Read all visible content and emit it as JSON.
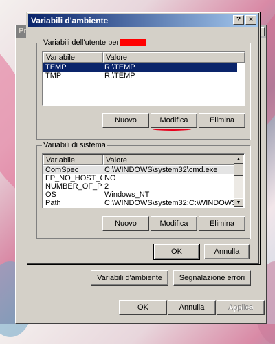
{
  "background_window": {
    "title": "Pro",
    "close_label": "×",
    "buttons": {
      "env_vars": "Variabili d'ambiente",
      "error_report": "Segnalazione errori",
      "ok": "OK",
      "cancel": "Annulla",
      "apply": "Applica"
    }
  },
  "dialog": {
    "title": "Variabili d'ambiente",
    "help_label": "?",
    "close_label": "×",
    "user_group": {
      "label": "Variabili dell'utente per",
      "columns": [
        "Variabile",
        "Valore"
      ],
      "rows": [
        {
          "name": "TEMP",
          "value": "R:\\TEMP",
          "selected": true
        },
        {
          "name": "TMP",
          "value": "R:\\TEMP",
          "selected": false
        }
      ],
      "buttons": {
        "new": "Nuovo",
        "edit": "Modifica",
        "delete": "Elimina"
      }
    },
    "system_group": {
      "label": "Variabili di sistema",
      "columns": [
        "Variabile",
        "Valore"
      ],
      "rows": [
        {
          "name": "ComSpec",
          "value": "C:\\WINDOWS\\system32\\cmd.exe"
        },
        {
          "name": "FP_NO_HOST_C...",
          "value": "NO"
        },
        {
          "name": "NUMBER_OF_P...",
          "value": "2"
        },
        {
          "name": "OS",
          "value": "Windows_NT"
        },
        {
          "name": "Path",
          "value": "C:\\WINDOWS\\system32;C:\\WINDOWS;..."
        }
      ],
      "buttons": {
        "new": "Nuovo",
        "edit": "Modifica",
        "delete": "Elimina"
      }
    },
    "ok": "OK",
    "cancel": "Annulla"
  },
  "colors": {
    "title_active": "#0a246a",
    "selection": "#0a246a",
    "face": "#d4d0c8",
    "redaction": "#ff0000",
    "annotation": "#e8001c"
  }
}
